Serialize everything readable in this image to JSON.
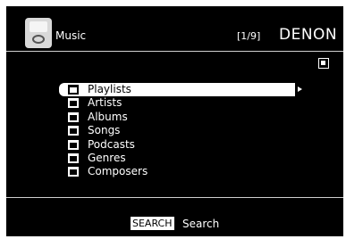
{
  "header": {
    "source_label": "Music",
    "page_count": "[1/9]",
    "brand": "DENON"
  },
  "menu": {
    "items": [
      {
        "label": "Playlists",
        "selected": true
      },
      {
        "label": "Artists"
      },
      {
        "label": "Albums"
      },
      {
        "label": "Songs"
      },
      {
        "label": "Podcasts"
      },
      {
        "label": "Genres"
      },
      {
        "label": "Composers"
      }
    ]
  },
  "footer": {
    "key_label": "SEARCH",
    "action_label": "Search"
  },
  "icons": [
    "ipod-icon",
    "stop-icon",
    "folder-icon",
    "arrow-right-icon"
  ],
  "colors": {
    "background": "#000000",
    "text": "#ffffff",
    "highlight": "#ffffff"
  }
}
